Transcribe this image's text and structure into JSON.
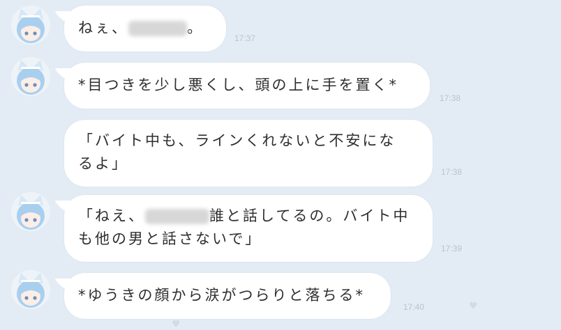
{
  "messages": [
    {
      "text_before": "ねぇ、",
      "text_after": "。",
      "time": "17:37"
    },
    {
      "text": "*目つきを少し悪くし、頭の上に手を置く*",
      "time": "17:38"
    },
    {
      "line1": "「バイト中も、ラインくれないと不安にな",
      "line2": "るよ」",
      "time": "17:38"
    },
    {
      "line1_before": "「ねえ、",
      "line1_after": "誰と話してるの。バイト中",
      "line2": "も他の男と話さないで」",
      "time": "17:39"
    },
    {
      "text": "*ゆうきの顔から涙がつらりと落ちる*",
      "time": "17:40"
    }
  ],
  "colors": {
    "background": "#e3ecf4",
    "bubble": "#ffffff",
    "text": "#2e2e2e",
    "time": "#b7c3cf",
    "avatar_hair": "#a9cfef"
  }
}
